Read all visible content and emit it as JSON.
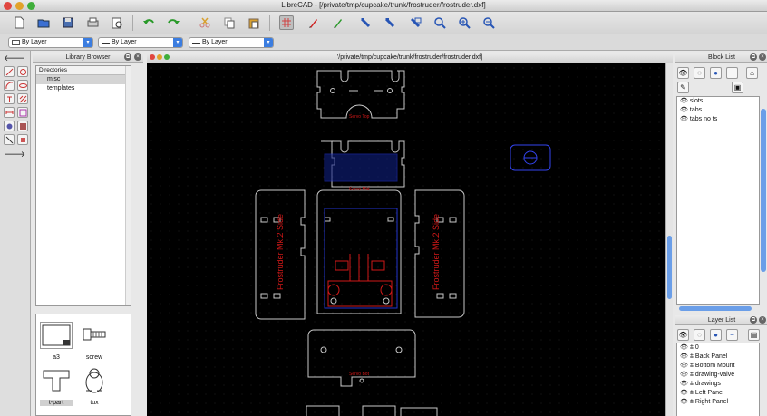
{
  "window": {
    "title": "LibreCAD - [/private/tmp/cupcake/trunk/frostruder/frostruder.dxf]",
    "traffic_colors": [
      "#e0463f",
      "#e2a22a",
      "#3fae3a"
    ]
  },
  "toolbar": {
    "icons": [
      "new-file-icon",
      "open-file-icon",
      "save-icon",
      "print-icon",
      "print-preview-icon",
      "undo-icon",
      "redo-icon",
      "cut-icon",
      "copy-icon",
      "paste-icon",
      "grid-icon",
      "draft-icon",
      "redraw-icon",
      "zoom-auto-icon",
      "zoom-previous-icon",
      "zoom-window-icon",
      "zoom-pan-icon",
      "zoom-in-icon",
      "zoom-out-icon"
    ]
  },
  "property_bar": {
    "color": "By Layer",
    "linetype": "By Layer",
    "linewidth": "By Layer"
  },
  "library_browser": {
    "title": "Library Browser",
    "directories_header": "Directories",
    "directories": [
      "misc",
      "templates"
    ],
    "selected_directory": "misc",
    "thumbnails": [
      "a3",
      "screw",
      "t-part",
      "tux"
    ],
    "selected_thumbnail": "t-part"
  },
  "canvas": {
    "title": "'/private/tmp/cupcake/trunk/frostruder/frostruder.dxf]",
    "labels": {
      "part_top": "Servo Top",
      "part_mid": "Servo Mid",
      "side_left": "Frostruder Mk.2 Side",
      "side_right": "Frostruder Mk.2 Side",
      "bottom": "Servo Bot"
    },
    "colors": {
      "background": "#000000",
      "outline": "#c8c8c8",
      "red": "#d01818",
      "blue": "#2233cc",
      "grid": "#1e1e1e"
    }
  },
  "block_list": {
    "title": "Block List",
    "items": [
      "slots",
      "tabs",
      "tabs no ts"
    ]
  },
  "layer_list": {
    "title": "Layer List",
    "items": [
      "0",
      "Back Panel",
      "Bottom Mount",
      "drawing-valve",
      "drawings",
      "Left Panel",
      "Right Panel"
    ]
  }
}
